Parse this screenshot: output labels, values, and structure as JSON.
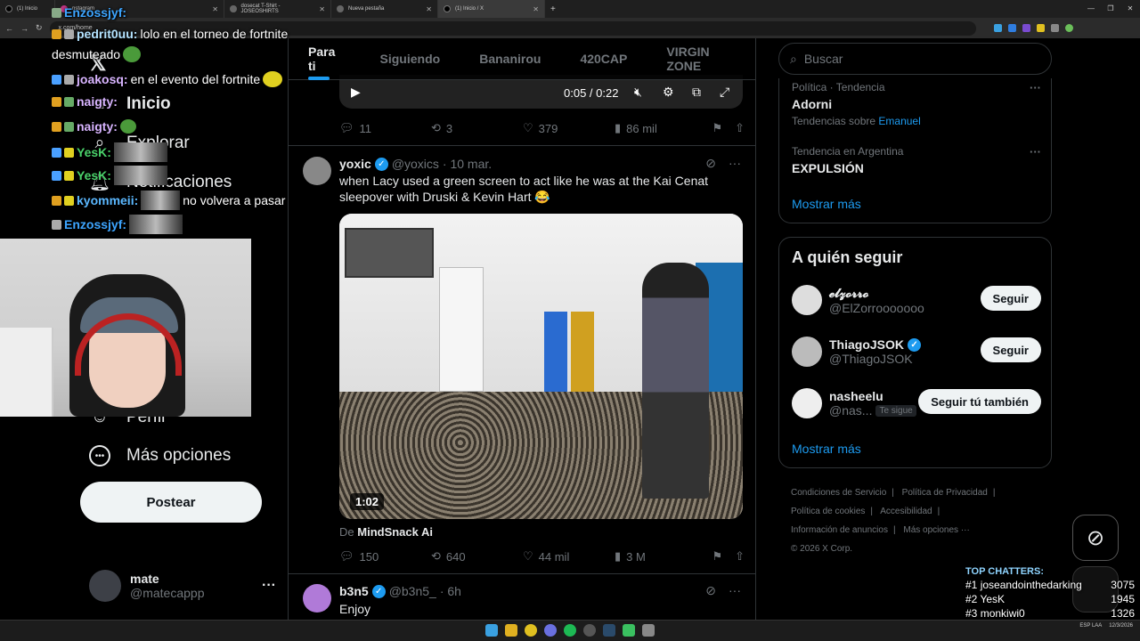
{
  "browser": {
    "tabs": [
      {
        "label": "(1) Inicio",
        "active": false
      },
      {
        "label": "nstagram",
        "active": false
      },
      {
        "label": "dosecat T-Shirt - JOSEOSHIRTS",
        "active": false
      },
      {
        "label": "Nueva pestaña",
        "active": false
      },
      {
        "label": "(1) Inicio / X",
        "active": true
      }
    ],
    "url": "x.com/home"
  },
  "nav": {
    "home": "Inicio",
    "explore": "Explorar",
    "notifications": "Notificaciones",
    "more": "Más opciones",
    "profile": "Perfil",
    "post_button": "Postear",
    "account_name": "mate",
    "account_handle": "@matecappp"
  },
  "chat": [
    {
      "user": "Enzossjyf:",
      "text": "",
      "color": "#3da5ff"
    },
    {
      "user": "pedrit0uu:",
      "text": " lolo en el torneo de fortnite",
      "color": "#b4e3ff"
    },
    {
      "user": "",
      "text": "desmuteado",
      "color": "#ffffff"
    },
    {
      "user": "joakosq:",
      "text": " en el evento del fortnite",
      "color": "#d8b4ff"
    },
    {
      "user": "naigty:",
      "text": "",
      "color": "#d8b4ff"
    },
    {
      "user": "naigty:",
      "text": "",
      "color": "#d8b4ff"
    },
    {
      "user": "YesK:",
      "text": "",
      "color": "#4ad16a"
    },
    {
      "user": "YesK:",
      "text": "",
      "color": "#4ad16a"
    },
    {
      "user": "kyommeii:",
      "text": " no volvera a pasar",
      "color": "#5bb8ff"
    },
    {
      "user": "Enzossjyf:",
      "text": "",
      "color": "#3da5ff"
    }
  ],
  "feed": {
    "tabs": [
      "Para ti",
      "Siguiendo",
      "Bananirou",
      "420CAP",
      "VIRGIN ZONE"
    ],
    "video_time": "0:05 / 0:22",
    "post1_stats": {
      "replies": "11",
      "reposts": "3",
      "likes": "379",
      "views": "86 mil"
    },
    "post2": {
      "name": "yoxic",
      "handle": "@yoxics",
      "date": "· 10 mar.",
      "text": "when Lacy used a green screen to act like he was at the Kai Cenat sleepover with Druski & Kevin Hart 😂",
      "duration": "1:02",
      "from_prefix": "De",
      "from_name": "MindSnack Ai",
      "stats": {
        "replies": "150",
        "reposts": "640",
        "likes": "44 mil",
        "views": "3 M"
      }
    },
    "post3": {
      "name": "b3n5",
      "handle": "@b3n5_",
      "date": "· 6h",
      "text": "Enjoy"
    }
  },
  "sidebar": {
    "search_placeholder": "Buscar",
    "trends": [
      {
        "meta": "Política · Tendencia",
        "title": "Adorni",
        "sub_prefix": "Tendencias sobre",
        "sub_link": "Emanuel"
      },
      {
        "meta": "Tendencia en Argentina",
        "title": "EXPULSIÓN"
      }
    ],
    "show_more": "Mostrar más",
    "who_to_follow_title": "A quién seguir",
    "follow": [
      {
        "name": "𝓮𝓵𝔃𝓸𝓻𝓻𝓸",
        "handle": "@ElZorrooooooo",
        "button": "Seguir",
        "verified": false
      },
      {
        "name": "ThiagoJSOK",
        "handle": "@ThiagoJSOK",
        "button": "Seguir",
        "verified": true
      },
      {
        "name": "nasheelu",
        "handle": "@nas...",
        "button": "Seguir tú también",
        "follows_you": "Te sigue",
        "verified": false
      }
    ],
    "footer": [
      "Condiciones de Servicio",
      "Política de Privacidad",
      "Política de cookies",
      "Accesibilidad",
      "Información de anuncios",
      "Más opciones ···",
      "© 2026 X Corp."
    ]
  },
  "top_chatters": {
    "title": "TOP CHATTERS:",
    "rows": [
      {
        "rank": "#1",
        "name": "joseandointhedarking",
        "count": "3075"
      },
      {
        "rank": "#2",
        "name": "YesK",
        "count": "1945"
      },
      {
        "rank": "#3",
        "name": "monkiwi0",
        "count": "1326"
      }
    ]
  },
  "taskbar": {
    "lang": "ESP LAA",
    "date": "12/3/2026"
  },
  "colors": {
    "accent": "#1d9bf0",
    "background": "#000000",
    "border": "#2f3336",
    "muted": "#71767b"
  }
}
